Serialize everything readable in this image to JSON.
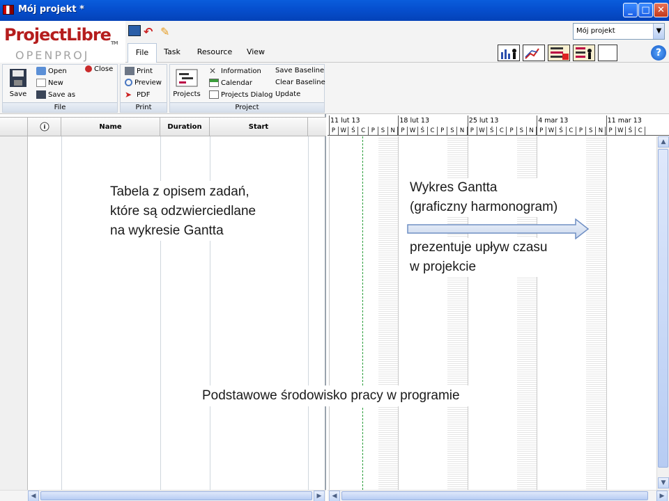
{
  "window": {
    "title": "Mój projekt *"
  },
  "logo": {
    "brand": "ProjectLibre",
    "tm": "TM",
    "sub": "OPENPROJ"
  },
  "tabs": [
    {
      "label": "File"
    },
    {
      "label": "Task"
    },
    {
      "label": "Resource"
    },
    {
      "label": "View"
    }
  ],
  "project_select": {
    "value": "Mój projekt"
  },
  "ribbon": {
    "file": {
      "label": "File",
      "save": "Save",
      "open": "Open",
      "close": "Close",
      "new": "New",
      "save_as": "Save as"
    },
    "print": {
      "label": "Print",
      "print": "Print",
      "preview": "Preview",
      "pdf": "PDF"
    },
    "project": {
      "label": "Project",
      "projects": "Projects",
      "information": "Information",
      "calendar": "Calendar",
      "projects_dialog": "Projects Dialog",
      "save_baseline": "Save Baseline",
      "clear_baseline": "Clear Baseline",
      "update": "Update"
    }
  },
  "table": {
    "headers": {
      "name": "Name",
      "duration": "Duration",
      "start": "Start"
    }
  },
  "gantt": {
    "weeks": [
      "11 lut 13",
      "18 lut 13",
      "25 lut 13",
      "4 mar 13",
      "11 mar 13"
    ],
    "days": [
      "P",
      "W",
      "Ś",
      "C",
      "P",
      "S",
      "N"
    ]
  },
  "annotations": {
    "table_desc": [
      "Tabela z opisem zadań,",
      "które są odzwierciedlane",
      "na wykresie Gantta"
    ],
    "gantt_title": [
      "Wykres Gantta",
      "(graficzny harmonogram)"
    ],
    "gantt_desc": [
      "prezentuje upływ czasu",
      "w projekcie"
    ],
    "bottom": "Podstawowe środowisko pracy w programie"
  },
  "colors": {
    "titlebar": "#0650d0",
    "brand_red": "#b51d1d",
    "today_line": "#2a9d3a",
    "arrow_blue": "#6f8fc4"
  }
}
